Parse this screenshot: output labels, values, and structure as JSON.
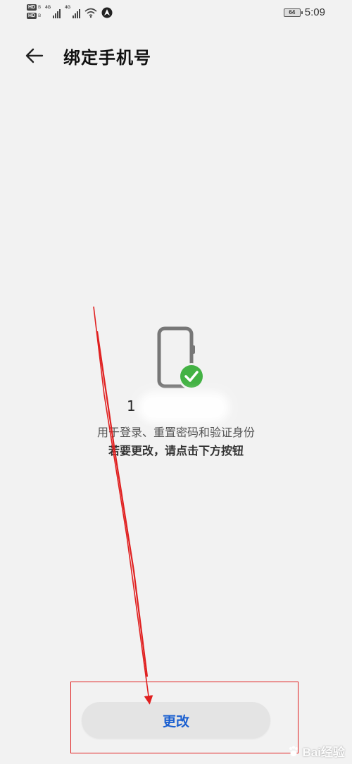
{
  "status_bar": {
    "hd_label": "HD",
    "hd_sub": "B",
    "network_1": "4G",
    "network_2": "4G",
    "battery_level": "64",
    "time": "5:09"
  },
  "app_bar": {
    "title": "绑定手机号"
  },
  "main": {
    "phone_number_visible": "1",
    "description": "用于登录、重置密码和验证身份",
    "instruction": "若要更改，请点击下方按钮"
  },
  "actions": {
    "change_label": "更改"
  },
  "annotation": {
    "color": "#e02020"
  },
  "watermark": {
    "text": "Bai经验"
  },
  "colors": {
    "background": "#f2f2f2",
    "accent": "#1a5fd0",
    "success": "#43b244",
    "button_bg": "#e4e4e4"
  }
}
